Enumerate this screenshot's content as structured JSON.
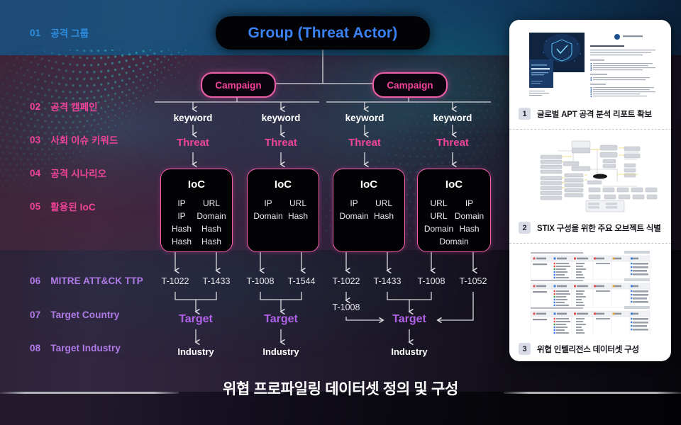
{
  "footer": {
    "title": "위협 프로파일링 데이터셋 정의 및 구성"
  },
  "sidebar": {
    "items": [
      {
        "num": "01",
        "label": "공격 그룹",
        "tone": "blue"
      },
      {
        "num": "02",
        "label": "공격 캠페인",
        "tone": "pink"
      },
      {
        "num": "03",
        "label": "사회 이슈 키워드",
        "tone": "pink"
      },
      {
        "num": "04",
        "label": "공격 시나리오",
        "tone": "pink"
      },
      {
        "num": "05",
        "label": "활용된 IoC",
        "tone": "pink"
      },
      {
        "num": "06",
        "label": "MITRE ATT&CK TTP",
        "tone": "violet"
      },
      {
        "num": "07",
        "label": "Target Country",
        "tone": "violet"
      },
      {
        "num": "08",
        "label": "Target Industry",
        "tone": "violet"
      }
    ]
  },
  "diagram": {
    "group_label": "Group (Threat Actor)",
    "campaigns": [
      "Campaign",
      "Campaign"
    ],
    "keyword_label": "keyword",
    "threat_label": "Threat",
    "target_label": "Target",
    "industry_label": "Industry",
    "ioc_title": "IoC",
    "branches": [
      {
        "keyword": "keyword",
        "threat": "Threat",
        "ioc": [
          "IP",
          "URL",
          "IP",
          "Domain",
          "Hash",
          "Hash",
          "Hash",
          "Hash"
        ],
        "ttps": [
          "T-1022",
          "T-1433"
        ]
      },
      {
        "keyword": "keyword",
        "threat": "Threat",
        "ioc": [
          "IP",
          "URL",
          "Domain",
          "Hash"
        ],
        "ttps": [
          "T-1008",
          "T-1544"
        ]
      },
      {
        "keyword": "keyword",
        "threat": "Threat",
        "ioc": [
          "IP",
          "URL",
          "Domain",
          "Hash"
        ],
        "ttps": [
          "T-1022",
          "T-1433"
        ],
        "ttp_sub": "T-1008"
      },
      {
        "keyword": "keyword",
        "threat": "Threat",
        "ioc": [
          "URL",
          "IP",
          "URL",
          "Domain",
          "Domain",
          "Hash",
          "Domain"
        ],
        "ttps": [
          "T-1008",
          "T-1052"
        ]
      }
    ],
    "targets": [
      "Target",
      "Target",
      "Target"
    ],
    "industries": [
      "Industry",
      "Industry",
      "Industry"
    ]
  },
  "panel": {
    "cards": [
      {
        "badge": "1",
        "caption": "글로벌 APT 공격 분석 리포트 확보",
        "thumb": "report-document-thumbnail"
      },
      {
        "badge": "2",
        "caption": "STIX 구성을 위한 주요 오브젝트 식별",
        "thumb": "stix-object-diagram-thumbnail"
      },
      {
        "badge": "3",
        "caption": "위협 인텔리전스 데이터셋 구성",
        "thumb": "threat-intel-dataset-table-thumbnail"
      }
    ]
  },
  "colors": {
    "accent_blue": "#3b82f6",
    "accent_pink": "#f0439a",
    "accent_violet": "#b163e8",
    "text_white": "#ffffff"
  }
}
